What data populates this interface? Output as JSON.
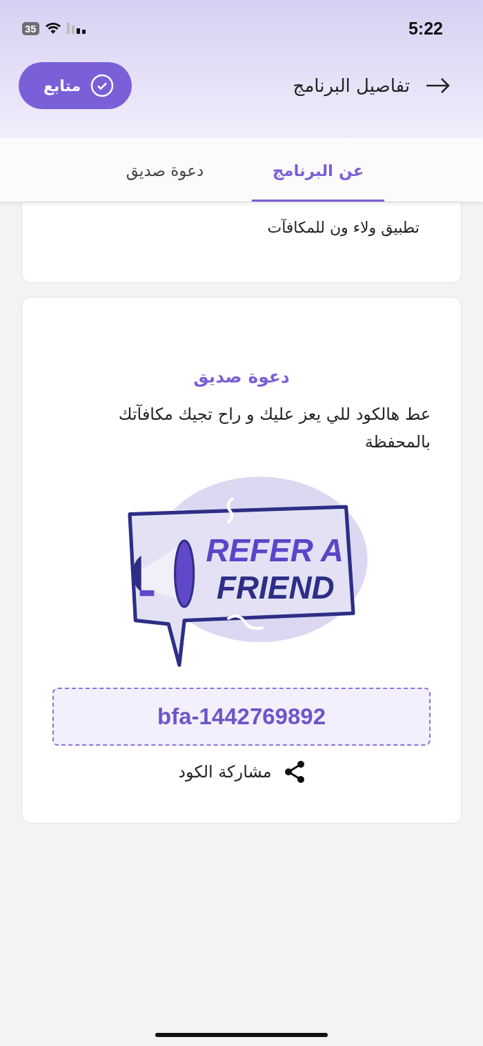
{
  "status_bar": {
    "time": "5:22",
    "battery": "35"
  },
  "header": {
    "title": "تفاصيل البرنامج",
    "follow_button": {
      "label": "متابع",
      "following": true
    }
  },
  "tabs": [
    {
      "label": "عن البرنامج",
      "selected": true
    },
    {
      "label": "دعوة صديق",
      "selected": false
    }
  ],
  "about_card": {
    "text_tail": "تطبيق ولاء ون للمكافآت"
  },
  "invite_card": {
    "title": "دعوة صديق",
    "description": "عط هالكود للي يعز عليك و راح تجيك مكافآتك بالمحفظة",
    "illustration_text": [
      "REFER A",
      "FRIEND"
    ],
    "code": "bfa-1442769892",
    "share_label": "مشاركة الكود"
  }
}
